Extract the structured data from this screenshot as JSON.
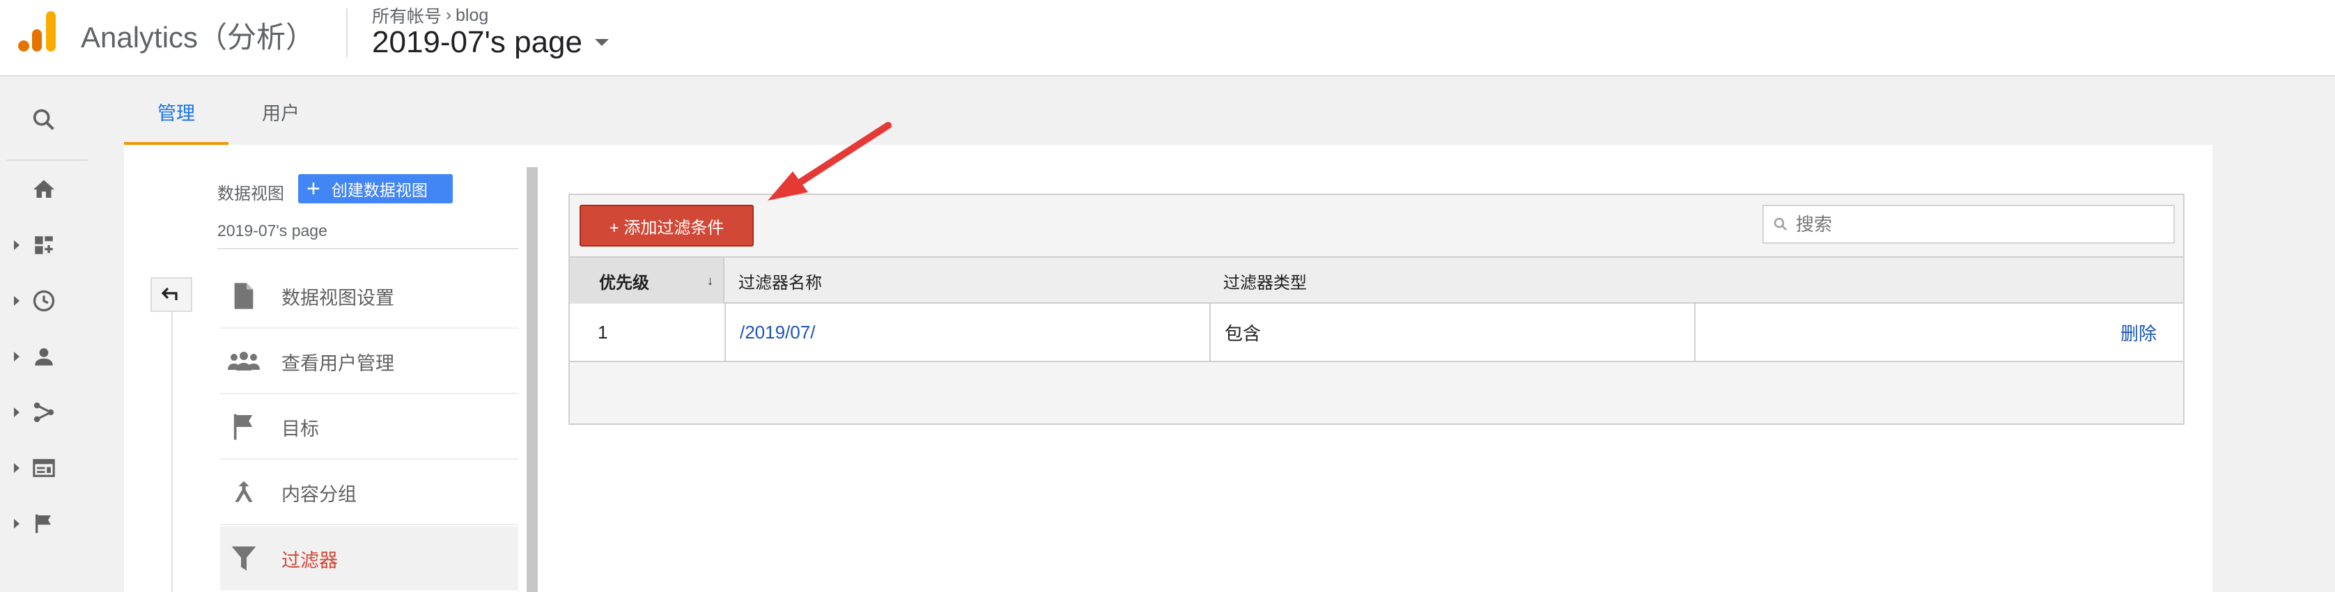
{
  "header": {
    "app_title": "Analytics（分析）",
    "breadcrumb": {
      "accounts": "所有帐号",
      "separator": "›",
      "account": "blog"
    },
    "view_name": "2019-07's page"
  },
  "rail": {
    "items": [
      {
        "icon": "search-icon"
      },
      {
        "icon": "home-icon"
      },
      {
        "icon": "customization-icon"
      },
      {
        "icon": "realtime-clock-icon"
      },
      {
        "icon": "audience-person-icon"
      },
      {
        "icon": "acquisition-icon"
      },
      {
        "icon": "behavior-icon"
      },
      {
        "icon": "conversions-flag-icon"
      }
    ]
  },
  "tabs": [
    {
      "label": "管理",
      "active": true
    },
    {
      "label": "用户",
      "active": false
    }
  ],
  "view_column": {
    "label": "数据视图",
    "create_button": "创建数据视图",
    "selected_view": "2019-07's page",
    "menu": [
      {
        "label": "数据视图设置",
        "icon": "document-icon",
        "active": false
      },
      {
        "label": "查看用户管理",
        "icon": "people-icon",
        "active": false
      },
      {
        "label": "目标",
        "icon": "flag-icon",
        "active": false
      },
      {
        "label": "内容分组",
        "icon": "content-grouping-icon",
        "active": false
      },
      {
        "label": "过滤器",
        "icon": "filter-icon",
        "active": true
      }
    ]
  },
  "filters": {
    "add_button": "+ 添加过滤条件",
    "search_placeholder": "搜索",
    "columns": [
      "优先级",
      "过滤器名称",
      "过滤器类型"
    ],
    "rows": [
      {
        "priority": "1",
        "name": "/2019/07/",
        "type": "包含",
        "action": "删除"
      }
    ]
  },
  "colors": {
    "accent_blue": "#4285f4",
    "link_blue": "#1a56b8",
    "active_red": "#d14836",
    "tab_underline": "#f29500",
    "annotation_arrow": "#e53935"
  }
}
